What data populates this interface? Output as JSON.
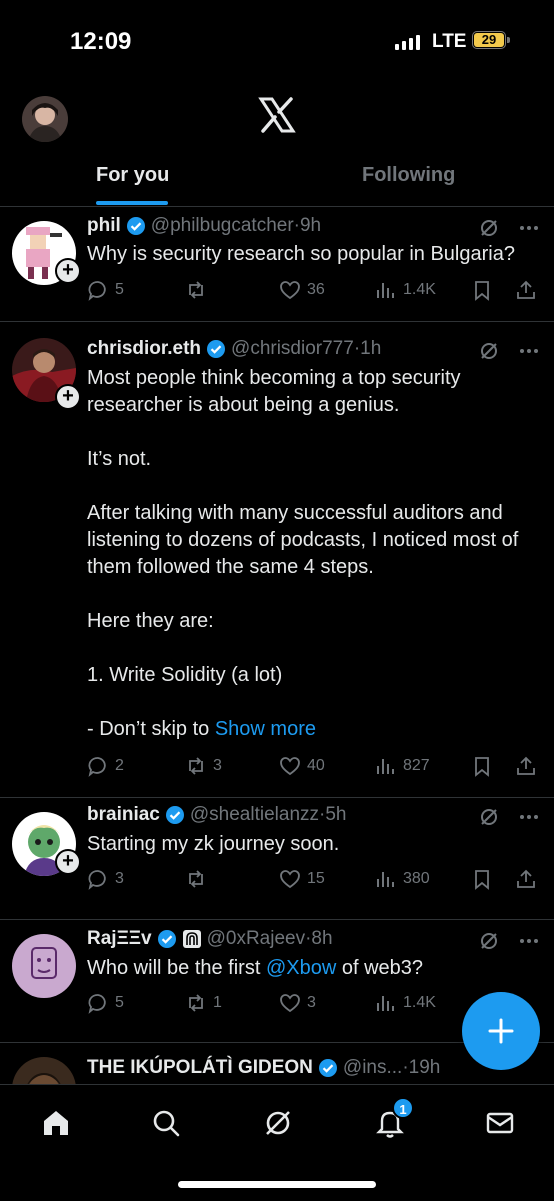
{
  "status": {
    "time": "12:09",
    "network": "LTE",
    "battery": "29"
  },
  "header": {
    "logo": "x-logo-icon",
    "tabs": [
      {
        "label": "For you",
        "active": true
      },
      {
        "label": "Following",
        "active": false
      }
    ]
  },
  "colors": {
    "accent": "#1d9bf0",
    "text": "#e7e9ea",
    "muted": "#71767b",
    "background": "#000000"
  },
  "posts": [
    {
      "name": "phil",
      "handle": "@philbugcatcher",
      "time": "9h",
      "text": [
        "Why is security research so popular in Bulgaria?"
      ],
      "replies": "5",
      "reposts": "",
      "likes": "36",
      "views": "1.4K"
    },
    {
      "name": "chrisdior.eth",
      "handle": "@chrisdior777",
      "time": "1h",
      "text": [
        "Most people think becoming a top security researcher is about being a genius.",
        "It’s not.",
        "After talking with many successful auditors and listening to dozens of podcasts, I noticed most of them followed the same 4 steps.",
        "Here they are:",
        "1. Write Solidity (a lot)",
        "- Don’t skip to"
      ],
      "show_more": "Show more",
      "replies": "2",
      "reposts": "3",
      "likes": "40",
      "views": "827"
    },
    {
      "name": "brainiac",
      "handle": "@shealtielanzz",
      "time": "5h",
      "text": [
        "Starting my zk journey soon."
      ],
      "replies": "3",
      "reposts": "",
      "likes": "15",
      "views": "380"
    },
    {
      "name": "RajΞΞv",
      "handle": "@0xRajeev",
      "time": "8h",
      "text_prefix": "Who will be the first ",
      "mention": "@Xbow",
      "text_suffix": " of web3?",
      "replies": "5",
      "reposts": "1",
      "likes": "3",
      "views": "1.4K"
    },
    {
      "name": "THE IKÚPOLÁTÌ GIDEON",
      "handle": "@ins...",
      "time": "19h"
    }
  ],
  "nav": {
    "items": [
      "home-icon",
      "search-icon",
      "grok-icon",
      "notifications-icon",
      "messages-icon"
    ],
    "notification_count": "1"
  }
}
